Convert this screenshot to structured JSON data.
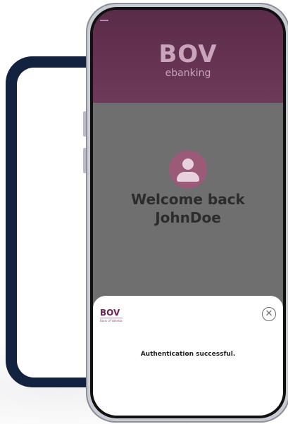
{
  "app": {
    "logo": "BOV",
    "logo_subtitle": "ebanking"
  },
  "welcome": {
    "line1": "Welcome back",
    "username": "JohnDoe"
  },
  "auth_sheet": {
    "bank_mark": "BOV",
    "bank_tagline": "Bank of Valletta",
    "close_icon": "close-icon",
    "message": "Authentication successful."
  },
  "colors": {
    "header": "#5a2b48",
    "dim_overlay": "#6f6f6f",
    "avatar": "#9a5a78",
    "back_phone": "#13233f"
  }
}
